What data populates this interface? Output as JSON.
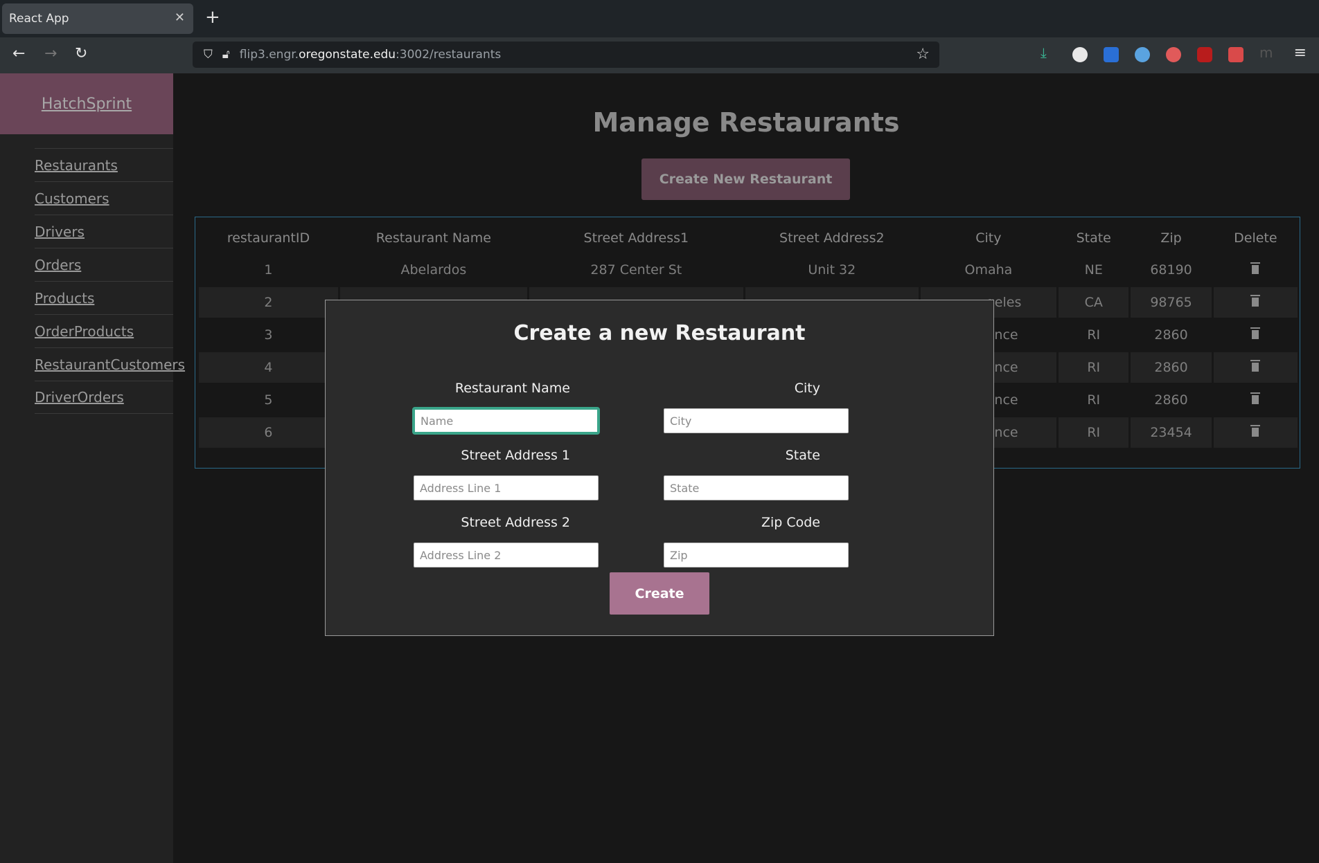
{
  "browser": {
    "tab_title": "React App",
    "url_prefix": "flip3.engr.",
    "url_host": "oregonstate.edu",
    "url_suffix": ":3002/restaurants"
  },
  "sidebar": {
    "brand": "HatchSprint",
    "items": [
      {
        "label": "Restaurants"
      },
      {
        "label": "Customers"
      },
      {
        "label": "Drivers"
      },
      {
        "label": "Orders"
      },
      {
        "label": "Products"
      },
      {
        "label": "OrderProducts"
      },
      {
        "label": "RestaurantCustomers"
      },
      {
        "label": "DriverOrders"
      }
    ]
  },
  "main": {
    "title": "Manage Restaurants",
    "create_button": "Create New Restaurant"
  },
  "table": {
    "headers": [
      "restaurantID",
      "Restaurant Name",
      "Street Address1",
      "Street Address2",
      "City",
      "State",
      "Zip",
      "Delete"
    ],
    "rows": [
      {
        "id": "1",
        "name": "Abelardos",
        "addr1": "287 Center St",
        "addr2": "Unit 32",
        "city": "Omaha",
        "state": "NE",
        "zip": "68190"
      },
      {
        "id": "2",
        "name": "",
        "addr1": "",
        "addr2": "",
        "city": "geles",
        "state": "CA",
        "zip": "98765"
      },
      {
        "id": "3",
        "name": "",
        "addr1": "",
        "addr2": "",
        "city": "ence",
        "state": "RI",
        "zip": "2860"
      },
      {
        "id": "4",
        "name": "",
        "addr1": "",
        "addr2": "",
        "city": "ence",
        "state": "RI",
        "zip": "2860"
      },
      {
        "id": "5",
        "name": "",
        "addr1": "",
        "addr2": "",
        "city": "ence",
        "state": "RI",
        "zip": "2860"
      },
      {
        "id": "6",
        "name": "",
        "addr1": "",
        "addr2": "",
        "city": "ence",
        "state": "RI",
        "zip": "23454"
      }
    ]
  },
  "modal": {
    "title": "Create a new Restaurant",
    "name_label": "Restaurant Name",
    "name_placeholder": "Name",
    "city_label": "City",
    "city_placeholder": "City",
    "addr1_label": "Street Address 1",
    "addr1_placeholder": "Address Line 1",
    "state_label": "State",
    "state_placeholder": "State",
    "addr2_label": "Street Address 2",
    "addr2_placeholder": "Address Line 2",
    "zip_label": "Zip Code",
    "zip_placeholder": "Zip",
    "create_label": "Create"
  }
}
